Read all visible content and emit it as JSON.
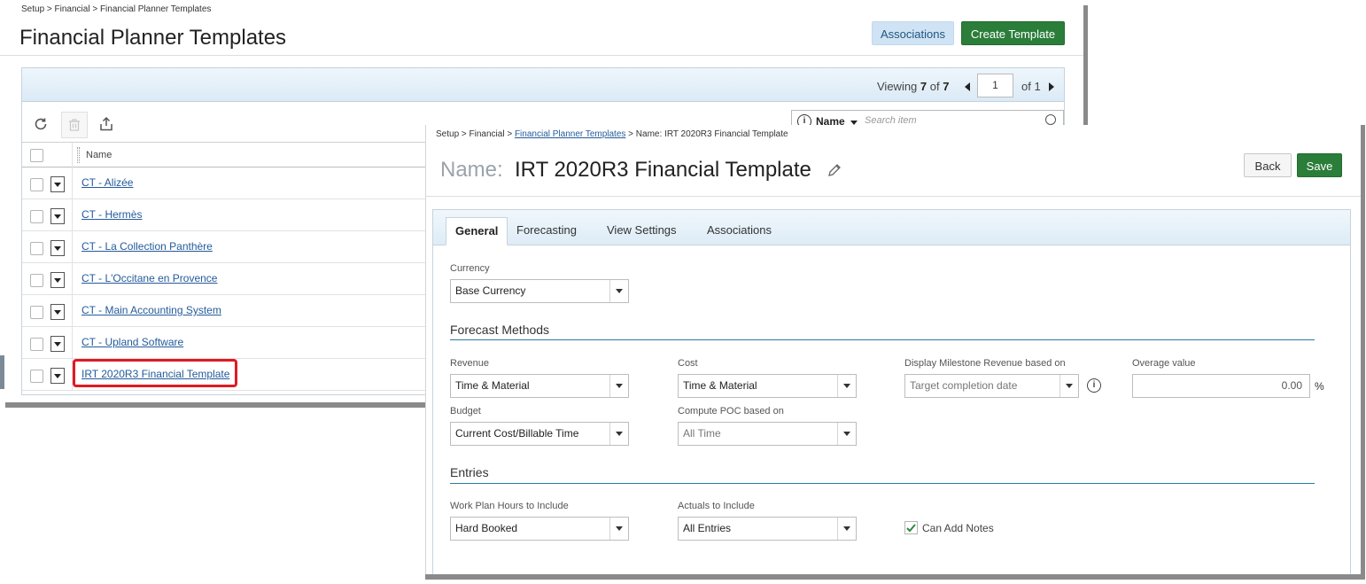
{
  "list_page": {
    "breadcrumb": "Setup > Financial > Financial Planner Templates",
    "title": "Financial Planner Templates",
    "associations_label": "Associations",
    "create_label": "Create Template",
    "viewing_prefix": "Viewing",
    "viewing_current": "7",
    "viewing_of": "of",
    "viewing_total": "7",
    "page_value": "1",
    "page_of": "of 1",
    "search_field": "Name",
    "search_placeholder": "Search item",
    "column_name": "Name",
    "rows": [
      {
        "name": "CT - Alizée"
      },
      {
        "name": "CT - Hermès"
      },
      {
        "name": "CT - La Collection Panthère"
      },
      {
        "name": "CT - L'Occitane en Provence"
      },
      {
        "name": "CT - Main Accounting System"
      },
      {
        "name": "CT - Upland Software"
      },
      {
        "name": "IRT 2020R3 Financial Template"
      }
    ]
  },
  "detail_page": {
    "breadcrumb_prefix": "Setup > Financial > ",
    "breadcrumb_link": "Financial Planner Templates",
    "breadcrumb_suffix": " > Name: IRT 2020R3 Financial Template",
    "name_label": "Name:",
    "name_value": "IRT 2020R3 Financial Template",
    "back_label": "Back",
    "save_label": "Save",
    "tabs": [
      "General",
      "Forecasting",
      "View Settings",
      "Associations"
    ],
    "currency_label": "Currency",
    "currency_value": "Base Currency",
    "forecast_methods_title": "Forecast Methods",
    "revenue_label": "Revenue",
    "revenue_value": "Time & Material",
    "cost_label": "Cost",
    "cost_value": "Time & Material",
    "milestone_label": "Display Milestone Revenue based on",
    "milestone_value": "Target completion date",
    "overage_label": "Overage value",
    "overage_value": "0.00",
    "overage_unit": "%",
    "budget_label": "Budget",
    "budget_value": "Current Cost/Billable Time",
    "poc_label": "Compute POC based on",
    "poc_value": "All Time",
    "entries_title": "Entries",
    "workplan_label": "Work Plan Hours to Include",
    "workplan_value": "Hard Booked",
    "actuals_label": "Actuals to Include",
    "actuals_value": "All Entries",
    "notes_label": "Can Add Notes",
    "notes_checked": true
  },
  "colors": {
    "accent_green": "#2b7d3a",
    "link_blue": "#245b9a",
    "highlight_red": "#e01a22",
    "section_rule": "#2c7a9a"
  }
}
